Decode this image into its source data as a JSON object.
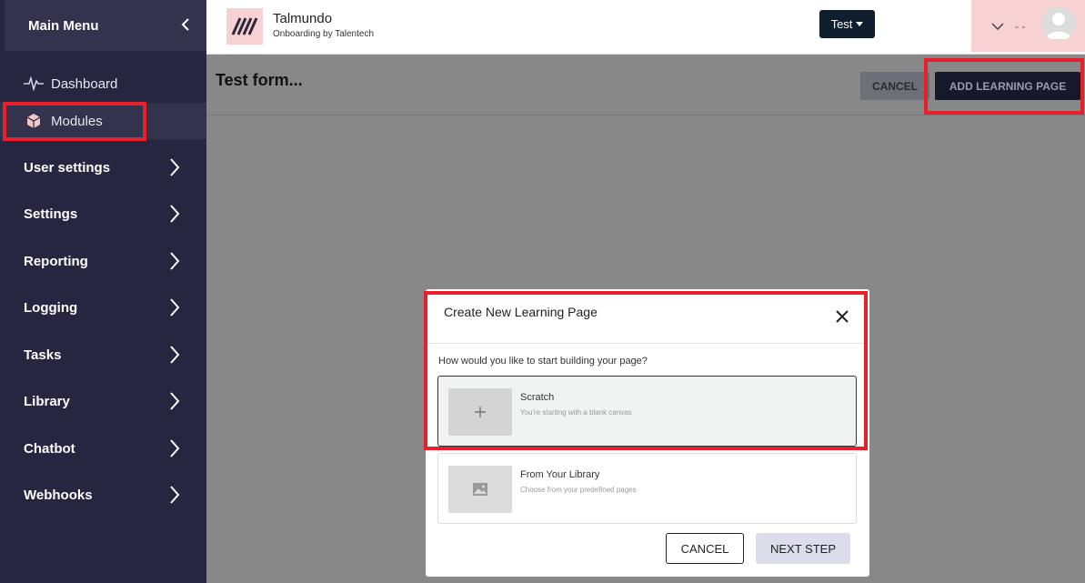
{
  "sidebar": {
    "title": "Main Menu",
    "items": [
      {
        "label": "Dashboard",
        "icon": "pulse-icon"
      },
      {
        "label": "Modules",
        "icon": "box-icon"
      }
    ],
    "groups": [
      {
        "label": "User settings"
      },
      {
        "label": "Settings"
      },
      {
        "label": "Reporting"
      },
      {
        "label": "Logging"
      },
      {
        "label": "Tasks"
      },
      {
        "label": "Library"
      },
      {
        "label": "Chatbot"
      },
      {
        "label": "Webhooks"
      }
    ]
  },
  "header": {
    "brand_name": "Talmundo",
    "brand_sub": "Onboarding by Talentech",
    "env_label": "Test",
    "user_name": "- -"
  },
  "page": {
    "title": "Test form...",
    "cancel_label": "CANCEL",
    "add_label": "ADD LEARNING PAGE"
  },
  "modal": {
    "title": "Create New Learning Page",
    "question": "How would you like to start building your page?",
    "options": [
      {
        "title": "Scratch",
        "desc": "You're starting with a blank canvas",
        "selected": true
      },
      {
        "title": "From Your Library",
        "desc": "Choose from your predefined pages",
        "selected": false
      }
    ],
    "cancel_label": "CANCEL",
    "next_label": "NEXT STEP"
  },
  "colors": {
    "sidebar_bg": "#262640",
    "highlight": "#e8202a",
    "brand_pink": "#f8d2d2"
  }
}
